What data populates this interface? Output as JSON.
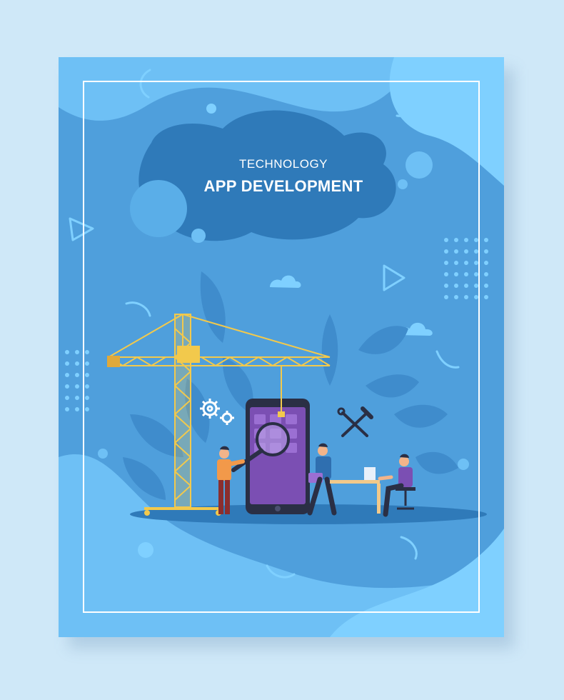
{
  "poster": {
    "subtitle": "TECHNOLOGY",
    "title": "APP DEVELOPMENT"
  },
  "palette": {
    "page_background": "#cfe8f8",
    "poster_base": "#4f9fdc",
    "blob_dark": "#2f7ab9",
    "blob_light": "#6ec0f5",
    "crane_yellow": "#f2c94c",
    "phone_purple": "#7b4fb3",
    "phone_body": "#2a2f45"
  },
  "icons": [
    "gears-icon",
    "wrench-hammer-icon",
    "magnifier-icon",
    "cloud-icon",
    "play-triangle-icon",
    "dot-grid-icon"
  ]
}
